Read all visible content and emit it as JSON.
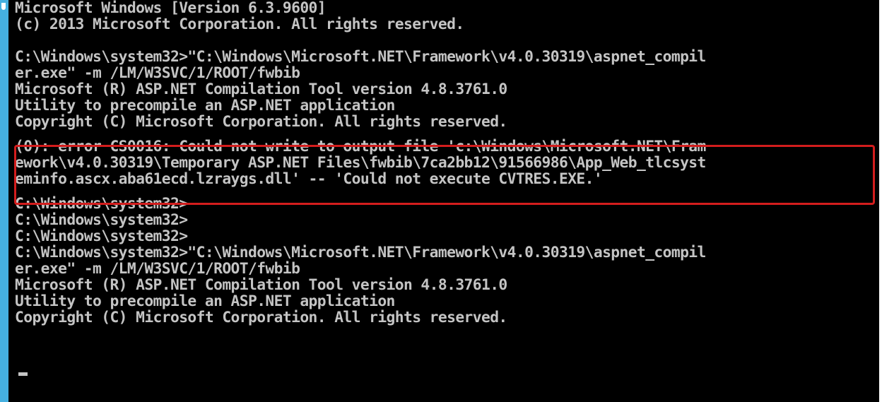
{
  "console": {
    "header": [
      "Microsoft Windows [Version 6.3.9600]",
      "(c) 2013 Microsoft Corporation. All rights reserved."
    ],
    "first_run": [
      "C:\\Windows\\system32>\"C:\\Windows\\Microsoft.NET\\Framework\\v4.0.30319\\aspnet_compil",
      "er.exe\" -m /LM/W3SVC/1/ROOT/fwbib",
      "Microsoft (R) ASP.NET Compilation Tool version 4.8.3761.0",
      "Utility to precompile an ASP.NET application",
      "Copyright (C) Microsoft Corporation. All rights reserved."
    ],
    "error": [
      "(0): error CS0016: Could not write to output file 'c:\\Windows\\Microsoft.NET\\Fram",
      "ework\\v4.0.30319\\Temporary ASP.NET Files\\fwbib\\7ca2bb12\\91566986\\App_Web_tlcsyst",
      "eminfo.ascx.aba61ecd.lzraygs.dll' -- 'Could not execute CVTRES.EXE.'"
    ],
    "prompts": [
      "C:\\Windows\\system32>",
      "C:\\Windows\\system32>",
      "C:\\Windows\\system32>"
    ],
    "second_run": [
      "C:\\Windows\\system32>\"C:\\Windows\\Microsoft.NET\\Framework\\v4.0.30319\\aspnet_compil",
      "er.exe\" -m /LM/W3SVC/1/ROOT/fwbib",
      "Microsoft (R) ASP.NET Compilation Tool version 4.8.3761.0",
      "Utility to precompile an ASP.NET application",
      "Copyright (C) Microsoft Corporation. All rights reserved."
    ]
  },
  "colors": {
    "background": "#000000",
    "text": "#c4c4c4",
    "highlight_border": "#d31d1d",
    "accent": "#45b0e0"
  }
}
